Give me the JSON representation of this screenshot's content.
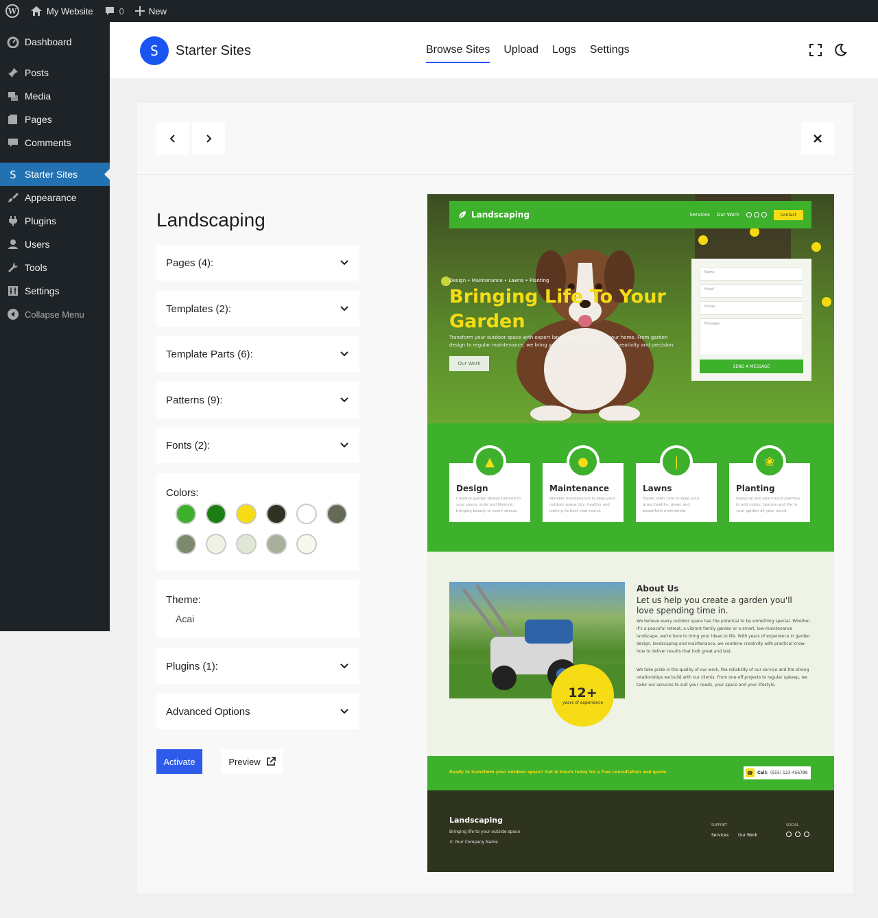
{
  "adminbar": {
    "site_name": "My Website",
    "comment_count": "0",
    "new_label": "New"
  },
  "sidebar": {
    "items": [
      {
        "label": "Dashboard",
        "icon": "dashboard-icon"
      },
      {
        "label": "Posts",
        "icon": "pin-icon"
      },
      {
        "label": "Media",
        "icon": "media-icon"
      },
      {
        "label": "Pages",
        "icon": "page-icon"
      },
      {
        "label": "Comments",
        "icon": "comment-icon"
      },
      {
        "label": "Starter Sites",
        "icon": "starter-sites-icon",
        "active": true
      },
      {
        "label": "Appearance",
        "icon": "brush-icon"
      },
      {
        "label": "Plugins",
        "icon": "plug-icon"
      },
      {
        "label": "Users",
        "icon": "user-icon"
      },
      {
        "label": "Tools",
        "icon": "wrench-icon"
      },
      {
        "label": "Settings",
        "icon": "settings-sliders-icon"
      }
    ],
    "collapse_label": "Collapse Menu"
  },
  "header": {
    "logo_letter": "S",
    "title": "Starter Sites",
    "tabs": [
      "Browse Sites",
      "Upload",
      "Logs",
      "Settings"
    ],
    "active_tab": "Browse Sites"
  },
  "details": {
    "site_title": "Landscaping",
    "sections": {
      "pages": "Pages (4):",
      "templates": "Templates (2):",
      "template_parts": "Template Parts (6):",
      "patterns": "Patterns (9):",
      "fonts": "Fonts (2):",
      "plugins": "Plugins (1):",
      "advanced": "Advanced Options"
    },
    "colors_label": "Colors:",
    "colors": [
      "#3db02c",
      "#1b7e12",
      "#f5dc14",
      "#2f3324",
      "#ffffff",
      "#636b57",
      "#7d8a6c",
      "#eef3e6",
      "#dfe8d5",
      "#a8b09c",
      "#f6f9ec"
    ],
    "theme_label": "Theme:",
    "theme_value": "Acai",
    "activate_label": "Activate",
    "preview_label": "Preview"
  },
  "preview_site": {
    "brand": "Landscaping",
    "nav_links": [
      "Services",
      "Our Work"
    ],
    "contact_label": "Contact",
    "hero_kicker": "Design • Maintenance • Lawns • Planting",
    "hero_title": "Bringing Life To Your Garden",
    "hero_sub": "Transform your outdoor space with expert landscaping tailored to your home. From garden design to regular maintenance, we bring your vision to life with care, creativity and precision.",
    "hero_button": "Our Work",
    "form": {
      "name": "Name",
      "email": "Email",
      "phone": "Phone",
      "message": "Message",
      "submit": "SEND A MESSAGE"
    },
    "services": [
      {
        "title": "Design",
        "text": "Creative garden design tailored to your space, style and lifestyle, bringing beauty to every season."
      },
      {
        "title": "Maintenance",
        "text": "Reliable maintenance to keep your outdoor space tidy, healthy and looking its best year-round."
      },
      {
        "title": "Lawns",
        "text": "Expert lawn care to keep your grass healthy, green and beautifully maintained."
      },
      {
        "title": "Planting",
        "text": "Seasonal and year-round planting to add colour, texture and life to your garden all year round."
      }
    ],
    "about": {
      "badge_number": "12+",
      "badge_label": "years of experience",
      "title": "About Us",
      "heading": "Let us help you create a garden you'll love spending time in.",
      "p1": "We believe every outdoor space has the potential to be something special. Whether it's a peaceful retreat, a vibrant family garden or a smart, low-maintenance landscape, we're here to bring your ideas to life. With years of experience in garden design, landscaping and maintenance, we combine creativity with practical know-how to deliver results that look great and last.",
      "p2": "We take pride in the quality of our work, the reliability of our service and the strong relationships we build with our clients. From one-off projects to regular upkeep, we tailor our services to suit your needs, your space and your lifestyle."
    },
    "cta": {
      "text": "Ready to transform your outdoor space? Get in touch today for a free consultation and quote.",
      "call_label": "Call:",
      "call_number": "(555) 123-456789"
    },
    "footer": {
      "title": "Landscaping",
      "sub": "Bringing life to your outside space",
      "copy": "© Your Company Name",
      "support_head": "SUPPORT",
      "support_links": [
        "Services",
        "Our Work"
      ],
      "social_head": "SOCIAL"
    }
  }
}
